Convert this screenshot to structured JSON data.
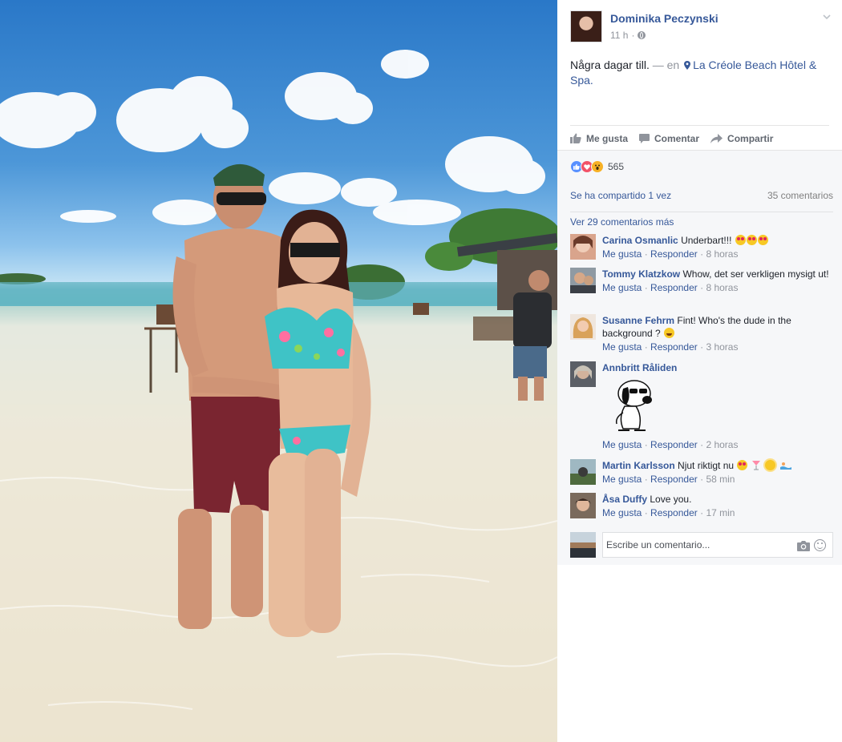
{
  "post": {
    "author": "Dominika Peczynski",
    "time": "11 h",
    "time_sep": "·",
    "text": "Några dagar till.",
    "location_sep": "— en",
    "location": "La Créole Beach Hôtel & Spa."
  },
  "actions": {
    "like": "Me gusta",
    "comment": "Comentar",
    "share": "Compartir"
  },
  "reactions": {
    "types": [
      "like",
      "love",
      "wow"
    ],
    "count": "565"
  },
  "stats": {
    "shared": "Se ha compartido 1 vez",
    "comments": "35 comentarios"
  },
  "view_more": "Ver 29 comentarios más",
  "comment_meta": {
    "like": "Me gusta",
    "reply": "Responder",
    "sep": "·"
  },
  "comments": [
    {
      "name": "Carina Osmanlic",
      "text": "Underbart!!!",
      "time": "8 horas"
    },
    {
      "name": "Tommy Klatzkow",
      "text": "Whow, det ser verkligen mysigt ut!",
      "time": "8 horas"
    },
    {
      "name": "Susanne Fehrm",
      "text": "Fint! Who's the dude in the background ?",
      "time": "3 horas"
    },
    {
      "name": "Annbritt Råliden",
      "text": "",
      "time": "2 horas"
    },
    {
      "name": "Martin Karlsson",
      "text": "Njut riktigt nu",
      "time": "58 min"
    },
    {
      "name": "Åsa Duffy",
      "text": "Love you.",
      "time": "17 min"
    }
  ],
  "composer": {
    "placeholder": "Escribe un comentario..."
  },
  "colors": {
    "link": "#365899",
    "meta": "#90949c",
    "feedback_bg": "#f6f7f9",
    "like": "#5890ff",
    "love": "#f25268",
    "wow": "#f7b125"
  },
  "icons": [
    "globe-icon",
    "chevron-down-icon",
    "location-pin-icon",
    "like-icon",
    "comment-icon",
    "share-icon",
    "camera-icon",
    "emoji-icon"
  ]
}
